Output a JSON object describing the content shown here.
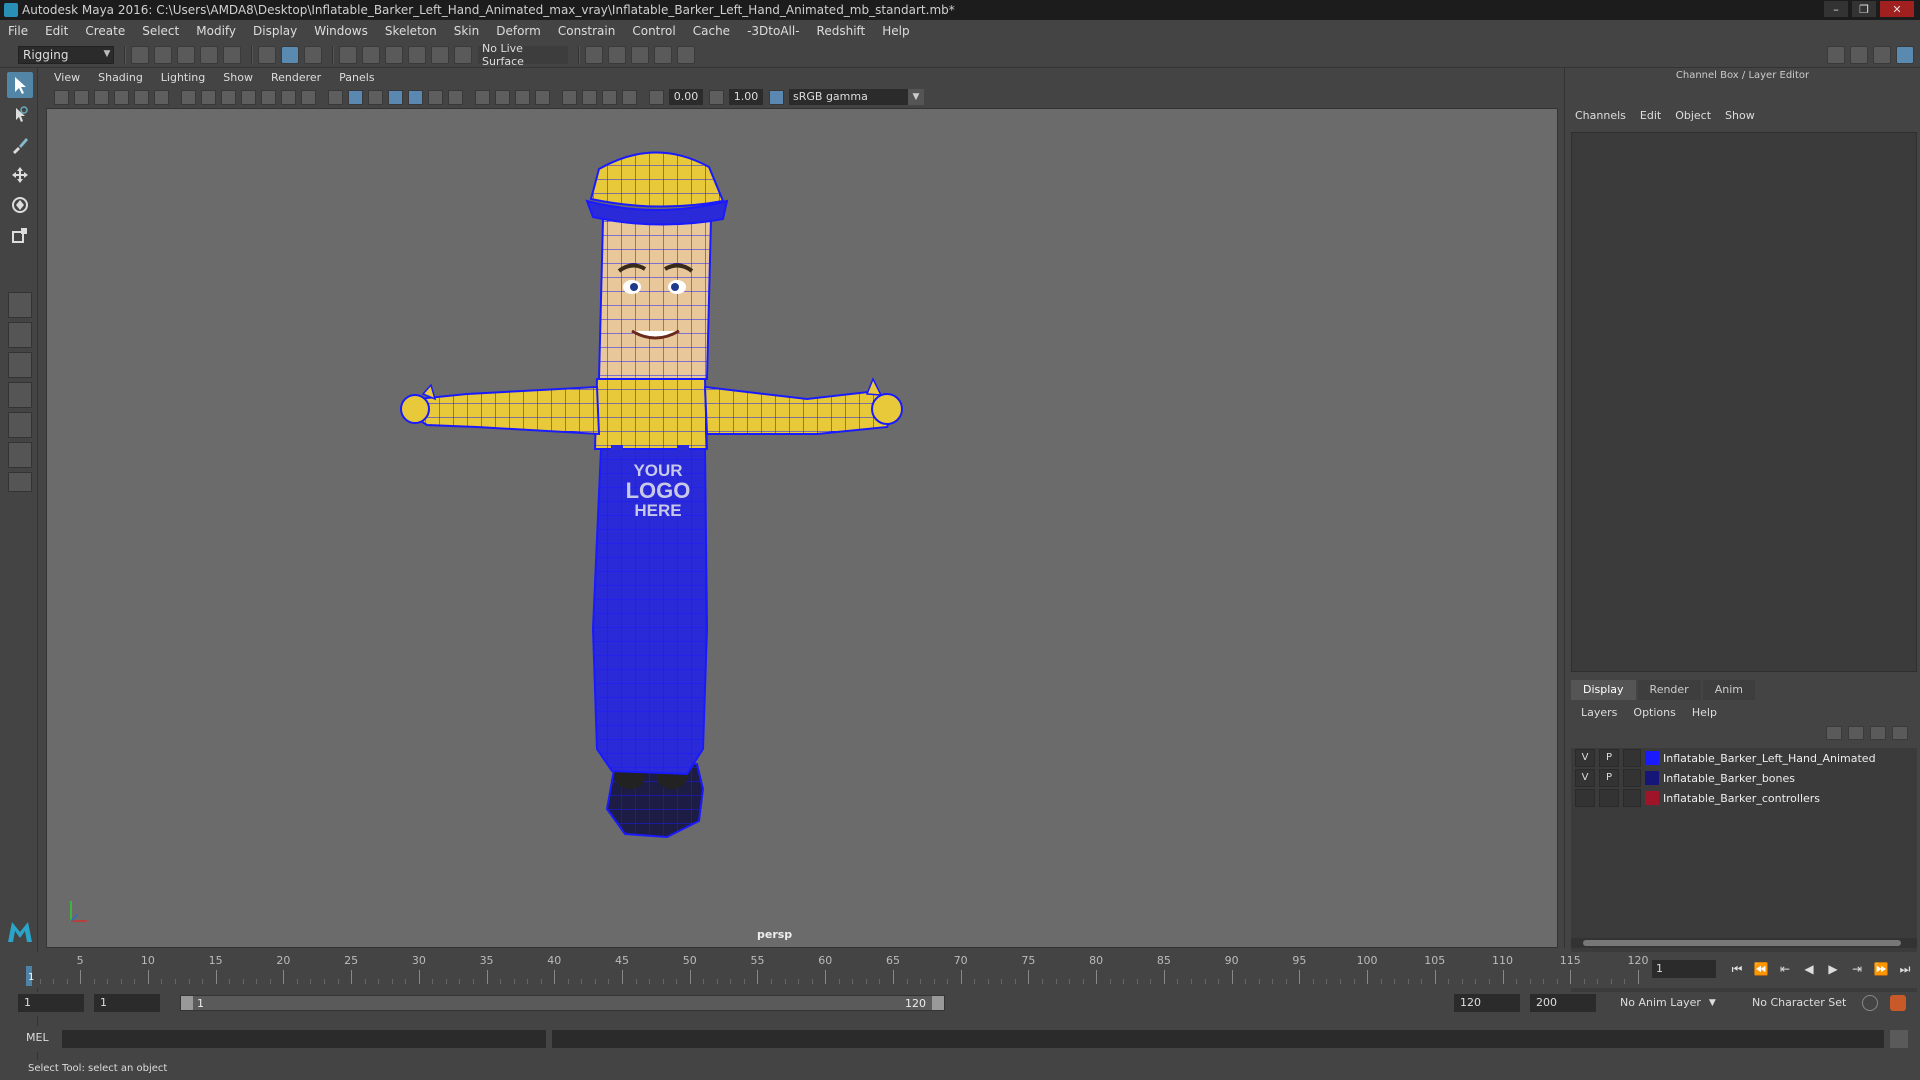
{
  "window": {
    "title": "Autodesk Maya 2016: C:\\Users\\AMDA8\\Desktop\\Inflatable_Barker_Left_Hand_Animated_max_vray\\Inflatable_Barker_Left_Hand_Animated_mb_standart.mb*",
    "minimize": "–",
    "maximize": "❐",
    "close": "✕"
  },
  "menubar": [
    "File",
    "Edit",
    "Create",
    "Select",
    "Modify",
    "Display",
    "Windows",
    "Skeleton",
    "Skin",
    "Deform",
    "Constrain",
    "Control",
    "Cache",
    "-3DtoAll-",
    "Redshift",
    "Help"
  ],
  "statusline": {
    "mode": "Rigging",
    "live_surface": "No Live Surface"
  },
  "viewport_menu": [
    "View",
    "Shading",
    "Lighting",
    "Show",
    "Renderer",
    "Panels"
  ],
  "viewport_toolbar": {
    "exposure": "0.00",
    "gamma": "1.00",
    "color_space": "sRGB gamma"
  },
  "viewport": {
    "camera": "persp",
    "model_text_line1": "YOUR",
    "model_text_line2": "LOGO",
    "model_text_line3": "HERE"
  },
  "right_panel": {
    "header": "Channel Box / Layer Editor",
    "channel_menu": [
      "Channels",
      "Edit",
      "Object",
      "Show"
    ],
    "tabs": [
      "Display",
      "Render",
      "Anim"
    ],
    "active_tab": "Display",
    "layer_menu": [
      "Layers",
      "Options",
      "Help"
    ],
    "layers": [
      {
        "v": "V",
        "p": "P",
        "name": "Inflatable_Barker_Left_Hand_Animated",
        "color": "#1a1aff"
      },
      {
        "v": "V",
        "p": "P",
        "name": "Inflatable_Barker_bones",
        "color": "#15157a"
      },
      {
        "v": "",
        "p": "",
        "name": "Inflatable_Barker_controllers",
        "color": "#a0142a"
      }
    ]
  },
  "timeslider": {
    "ticks": [
      "5",
      "10",
      "15",
      "20",
      "25",
      "30",
      "35",
      "40",
      "45",
      "50",
      "55",
      "60",
      "65",
      "70",
      "75",
      "80",
      "85",
      "90",
      "95",
      "100",
      "105",
      "110",
      "115",
      "120"
    ],
    "current_frame_label": "1",
    "current_frame": "1"
  },
  "rangeslider": {
    "start": "1",
    "playback_start": "1",
    "range_start_label": "1",
    "range_end_label": "120",
    "playback_end": "120",
    "end": "200",
    "anim_layer": "No Anim Layer",
    "character_set": "No Character Set"
  },
  "cmdline": {
    "label": "MEL"
  },
  "helpline": {
    "text": "Select Tool: select an object"
  },
  "colors": {
    "accent": "#5285a6",
    "wireframe": "#1a1aff",
    "model_yellow": "#e8c93a",
    "viewport_bg": "#6b6b6b"
  }
}
